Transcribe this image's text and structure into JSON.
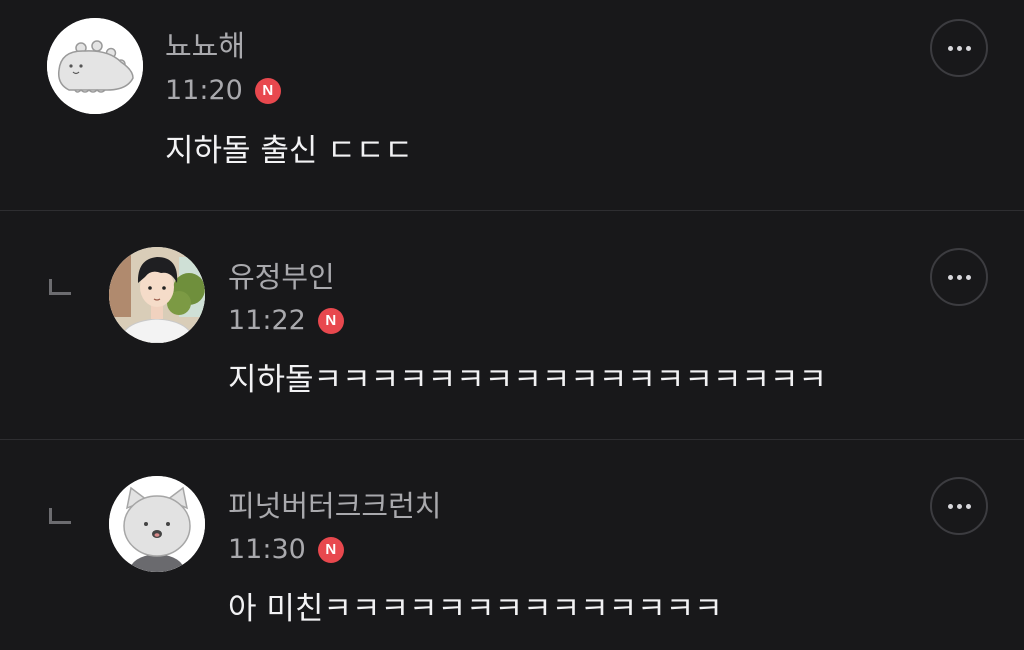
{
  "comments": [
    {
      "username": "뇨뇨해",
      "time": "11:20",
      "badge": "N",
      "text": "지하돌 출신 ㄷㄷㄷ",
      "avatar_icon": "dinosaur-character-avatar",
      "is_reply": false
    },
    {
      "username": "유정부인",
      "time": "11:22",
      "badge": "N",
      "text": "지하돌ㅋㅋㅋㅋㅋㅋㅋㅋㅋㅋㅋㅋㅋㅋㅋㅋㅋㅋ",
      "avatar_icon": "webtoon-boy-avatar",
      "is_reply": true
    },
    {
      "username": "피넛버터크크런치",
      "time": "11:30",
      "badge": "N",
      "text": "아 미친ㅋㅋㅋㅋㅋㅋㅋㅋㅋㅋㅋㅋㅋㅋ",
      "avatar_icon": "cat-character-avatar",
      "is_reply": true
    }
  ],
  "colors": {
    "background": "#18181a",
    "badge": "#e8484e",
    "text_primary": "#f2f2f4",
    "text_secondary": "#a9a9ad"
  },
  "icons": {
    "more": "more-options-icon",
    "reply": "reply-indent-icon"
  }
}
